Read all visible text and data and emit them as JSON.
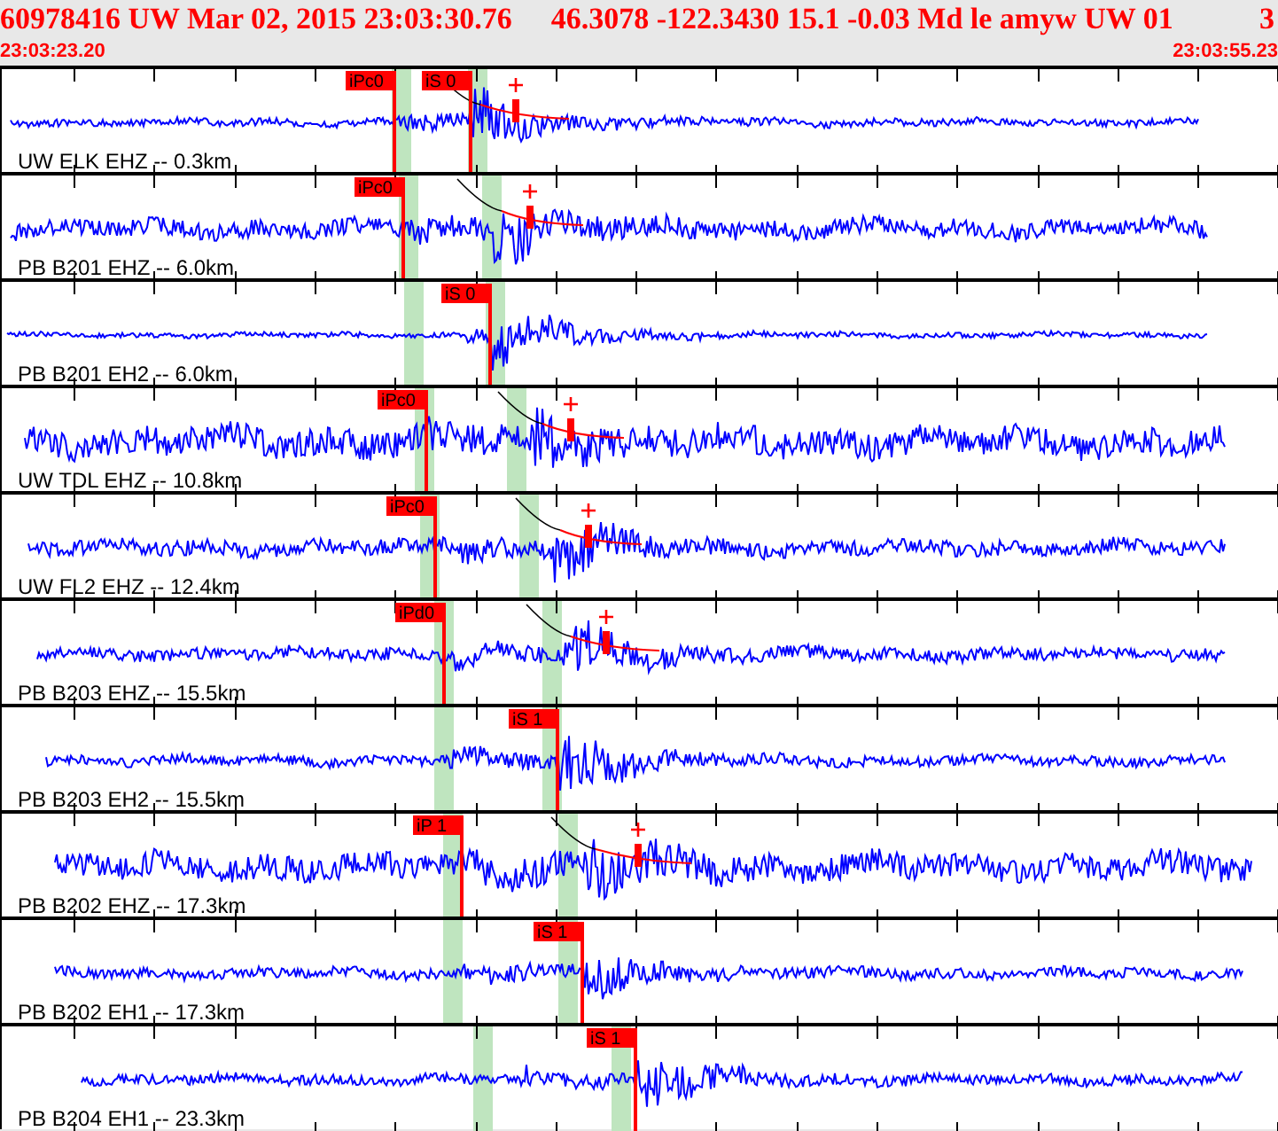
{
  "event": {
    "title": "60978416 UW Mar 02, 2015 23:03:30.76",
    "solution": "46.3078 -122.3430 15.1 -0.03 Md le amyw UW 01",
    "count": "3"
  },
  "time_range": {
    "start": "23:03:23.20",
    "end": "23:03:55.23"
  },
  "traces": [
    {
      "label": "UW ELK EHZ -- 0.3km",
      "picks": [
        "iPc0",
        "iS 0"
      ],
      "amplitude_pick": true
    },
    {
      "label": "PB B201 EHZ -- 6.0km",
      "picks": [
        "iPc0"
      ],
      "amplitude_pick": true
    },
    {
      "label": "PB B201 EH2 -- 6.0km",
      "picks": [
        "iS 0"
      ],
      "amplitude_pick": false
    },
    {
      "label": "UW TDL EHZ -- 10.8km",
      "picks": [
        "iPc0"
      ],
      "amplitude_pick": true
    },
    {
      "label": "UW FL2 EHZ -- 12.4km",
      "picks": [
        "iPc0"
      ],
      "amplitude_pick": true
    },
    {
      "label": "PB B203 EHZ -- 15.5km",
      "picks": [
        "iPd0"
      ],
      "amplitude_pick": true
    },
    {
      "label": "PB B203 EH2 -- 15.5km",
      "picks": [
        "iS 1"
      ],
      "amplitude_pick": false
    },
    {
      "label": "PB B202 EHZ -- 17.3km",
      "picks": [
        "iP 1"
      ],
      "amplitude_pick": true
    },
    {
      "label": "PB B202 EH1 -- 17.3km",
      "picks": [
        "iS 1"
      ],
      "amplitude_pick": false
    },
    {
      "label": "PB B204 EH1 -- 23.3km",
      "picks": [
        "iS 1"
      ],
      "amplitude_pick": false
    }
  ]
}
